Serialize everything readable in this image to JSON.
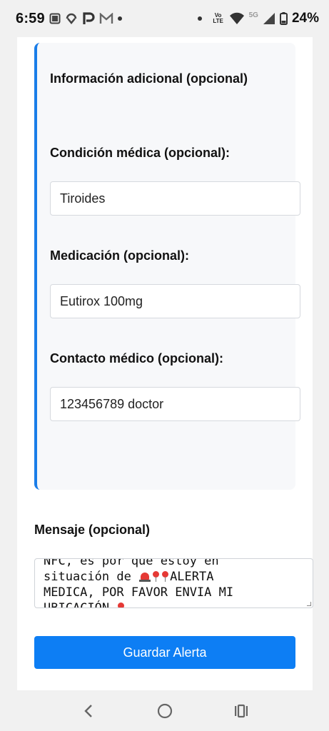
{
  "status_bar": {
    "time": "6:59",
    "battery_percent": "24%",
    "volte_label": "Vo LTE",
    "network_label": "5G",
    "icons": [
      "screenshot-icon",
      "cloud-sync-icon",
      "p-app-icon",
      "gmail-icon",
      "dot-icon",
      "dot-icon",
      "volte-icon",
      "wifi-icon",
      "signal-icon",
      "battery-icon"
    ]
  },
  "info_section": {
    "title": "Información adicional (opcional)",
    "accent_color": "#1a7de8",
    "fields": [
      {
        "label": "Condición médica (opcional):",
        "value": "Tiroides"
      },
      {
        "label": "Medicación (opcional):",
        "value": "Eutirox 100mg"
      },
      {
        "label": "Contacto médico (opcional):",
        "value": "123456789 doctor"
      }
    ]
  },
  "message": {
    "label": "Mensaje (opcional)",
    "line1": "NFC, es por que estoy en",
    "line2_prefix": "situación de ",
    "line2_suffix": "ALERTA",
    "line3": "MEDICA, POR FAVOR ENVIA MI",
    "line4": "UBICACIÓN "
  },
  "actions": {
    "save_label": "Guardar Alerta",
    "save_color": "#0d7ef4"
  },
  "nav_bar": {
    "buttons": [
      "back-icon",
      "home-icon",
      "recents-icon"
    ]
  }
}
